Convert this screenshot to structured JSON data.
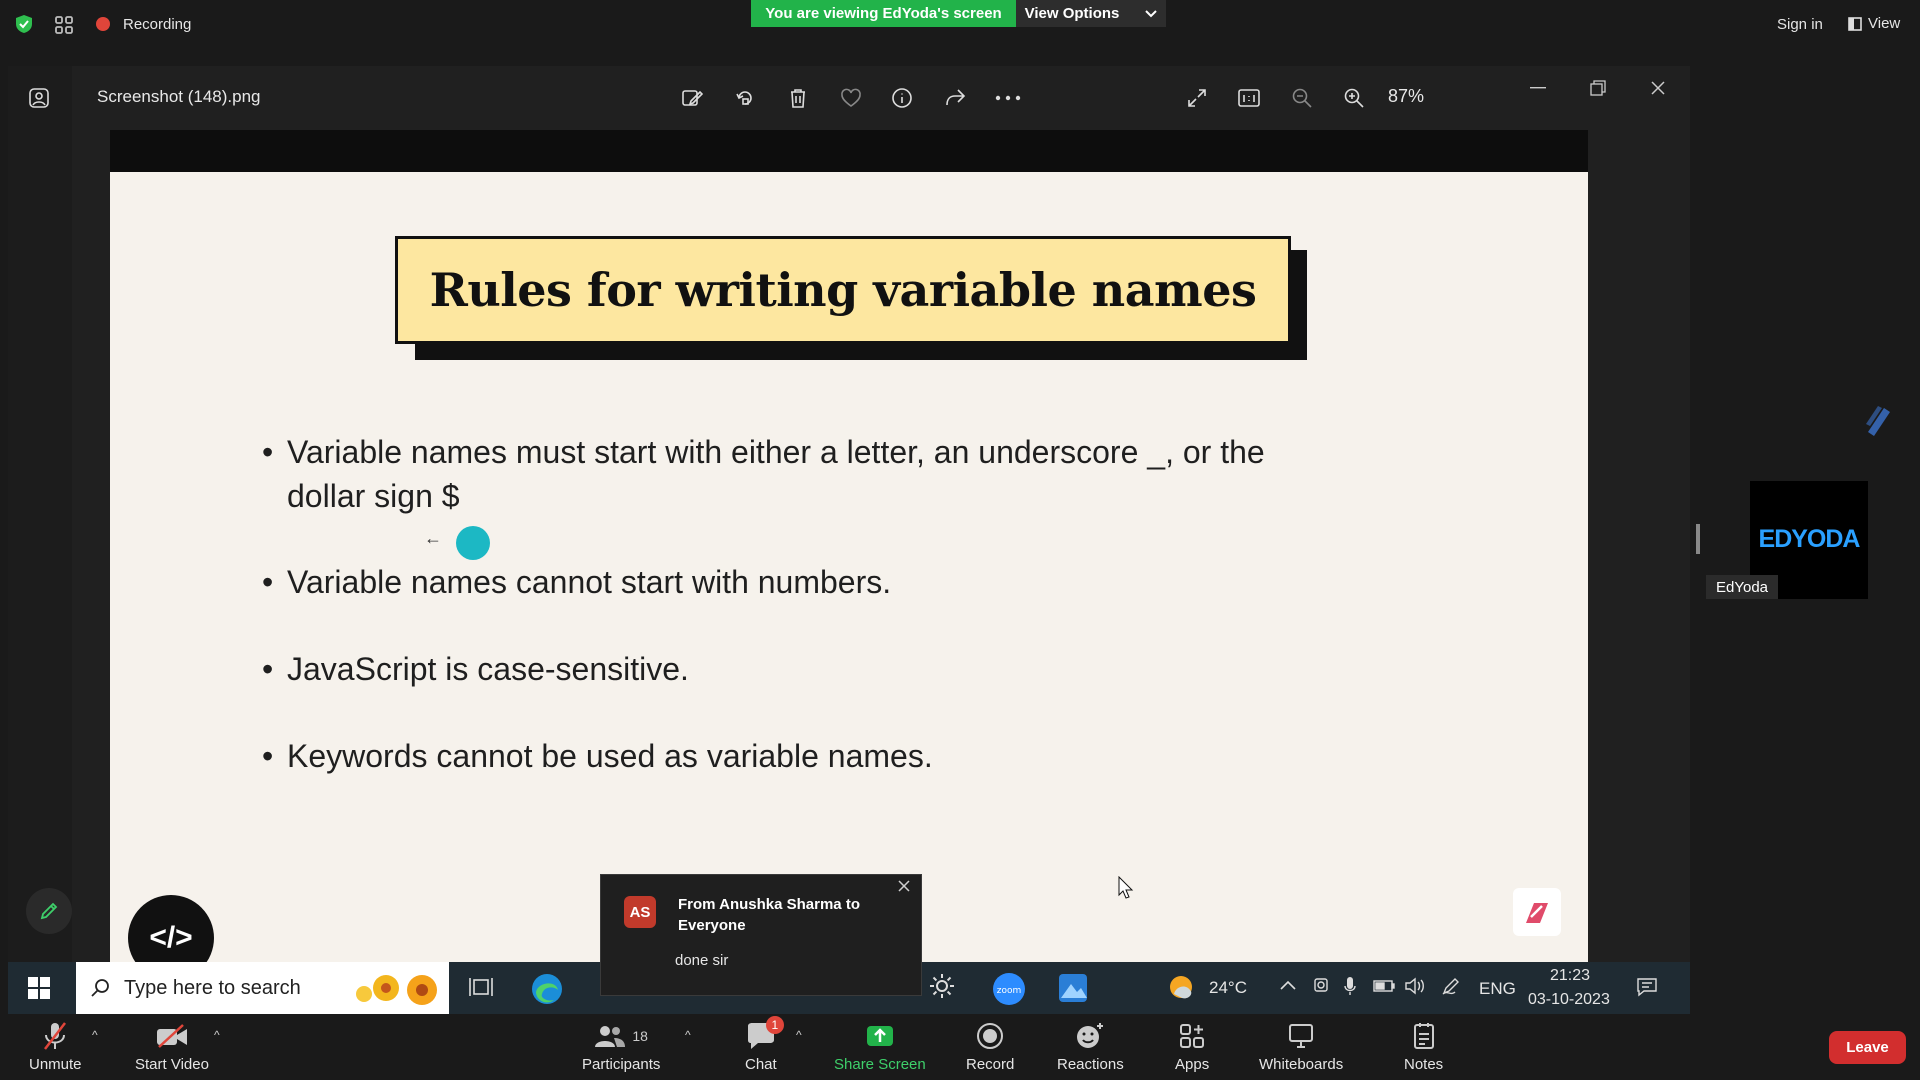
{
  "topbar": {
    "recording_label": "Recording",
    "viewing_banner": "You are viewing EdYoda's screen",
    "view_options": "View Options",
    "sign_in": "Sign in",
    "view": "View"
  },
  "photos": {
    "file_name": "Screenshot (148).png",
    "zoom": "87%"
  },
  "slide": {
    "title": "Rules for writing variable names",
    "bullets": [
      "Variable names must start with either a letter, an underscore _, or the",
      "dollar sign $",
      "Variable names cannot start with numbers.",
      "JavaScript is case-sensitive.",
      "Keywords cannot be used as variable names."
    ],
    "bullet_char": "•",
    "logo_glyph": "</>"
  },
  "taskbar": {
    "search_placeholder": "Type here to search",
    "temperature": "24°C",
    "language": "ENG",
    "time": "21:23",
    "date": "03-10-2023"
  },
  "chat_popup": {
    "initials": "AS",
    "from": "From Anushka Sharma to Everyone",
    "message": "done sir"
  },
  "participant_tile": {
    "logo_text": "EDYODA",
    "name": "EdYoda"
  },
  "toolbar": {
    "unmute": "Unmute",
    "start_video": "Start Video",
    "participants": "Participants",
    "participants_count": "18",
    "chat": "Chat",
    "chat_badge": "1",
    "share_screen": "Share Screen",
    "record": "Record",
    "reactions": "Reactions",
    "apps": "Apps",
    "whiteboards": "Whiteboards",
    "notes": "Notes",
    "leave": "Leave"
  },
  "colors": {
    "banner_green": "#22b34a",
    "leave_red": "#d22e2e",
    "slide_bg": "#f6f2ec",
    "title_yellow": "#fde7a0",
    "pointer_teal": "#1cb8c4"
  }
}
